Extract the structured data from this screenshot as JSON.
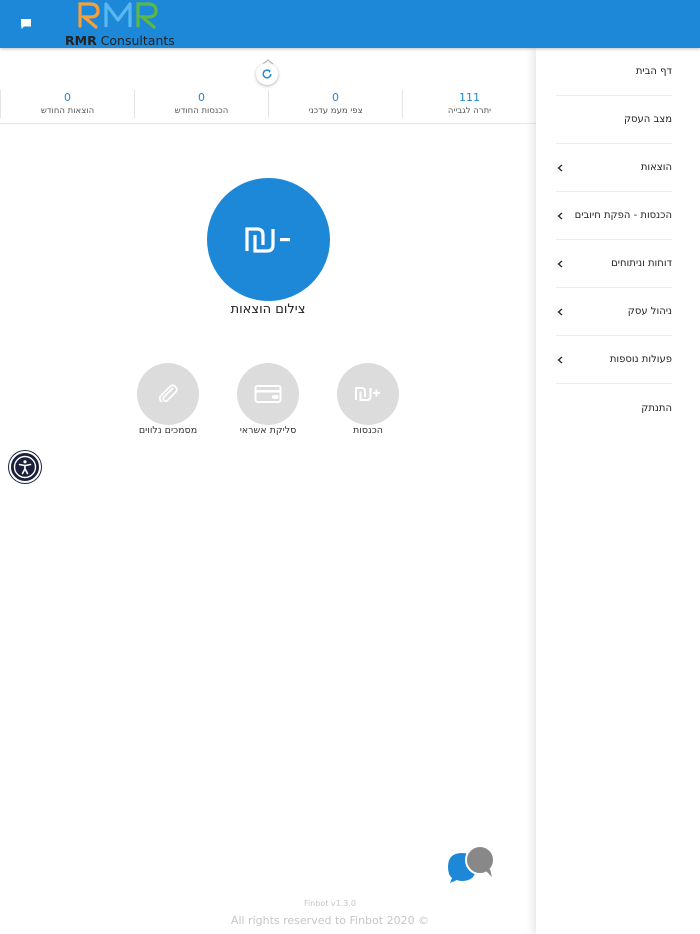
{
  "header": {
    "logo_letters": "RMR",
    "logo_brand_bold": "RMR",
    "logo_brand_rest": " Consultants",
    "chat_icon": "message-icon"
  },
  "sidebar": {
    "items": [
      {
        "label": "דף הבית",
        "has_submenu": false
      },
      {
        "label": "מצב העסק",
        "has_submenu": false
      },
      {
        "label": "הוצאות",
        "has_submenu": true
      },
      {
        "label": "הכנסות - הפקת חיובים",
        "has_submenu": true
      },
      {
        "label": "דוחות וניתוחים",
        "has_submenu": true
      },
      {
        "label": "ניהול עסק",
        "has_submenu": true
      },
      {
        "label": "פעולות נוספות",
        "has_submenu": true
      },
      {
        "label": "התנתק",
        "has_submenu": false
      }
    ]
  },
  "stats": [
    {
      "value": "111",
      "label": "יתרה לגבייה"
    },
    {
      "value": "0",
      "label": "צפי מעמ עדכני"
    },
    {
      "value": "0",
      "label": "הכנסות החודש"
    },
    {
      "value": "0",
      "label": "הוצאות החודש"
    }
  ],
  "main_action": {
    "label": "צילום הוצאות",
    "icon": "shekel-minus-icon"
  },
  "actions": [
    {
      "label": "הכנסות",
      "icon": "shekel-plus-icon"
    },
    {
      "label": "סליקת אשראי",
      "icon": "credit-card-icon"
    },
    {
      "label": "מסמכים נלווים",
      "icon": "paperclip-icon"
    }
  ],
  "footer": {
    "version": "Finbot v1.3.0",
    "copyright": "All rights reserved to Finbot 2020 ©"
  },
  "colors": {
    "primary": "#1d88d8",
    "action_grey": "#dcdcdc",
    "accessibility": "#1a1f3a"
  }
}
